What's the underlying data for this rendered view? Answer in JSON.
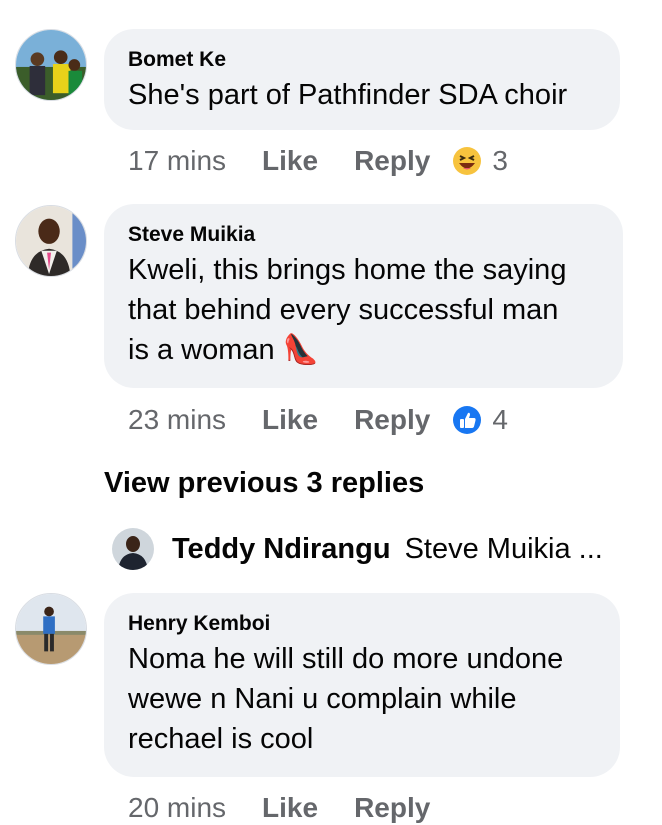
{
  "comments": [
    {
      "author": "Bomet Ke",
      "text": "She's part of Pathfinder SDA choir",
      "time": "17 mins",
      "like": "Like",
      "reply": "Reply",
      "reaction_icon": "laughing-emoji-icon",
      "reaction_count": "3"
    },
    {
      "author": "Steve Muikia",
      "text_lines": [
        "Kweli, this brings home the saying",
        "that behind every successful man",
        "is a woman 👠"
      ],
      "time": "23 mins",
      "like": "Like",
      "reply": "Reply",
      "reaction_icon": "thumbs-up-icon",
      "reaction_count": "4"
    },
    {
      "author": "Henry Kemboi",
      "text_lines": [
        "Noma he will still do more undone",
        "wewe n Nani u complain while",
        "rechael is cool"
      ],
      "time": "20 mins",
      "like": "Like",
      "reply": "Reply"
    }
  ],
  "view_previous": "View previous 3 replies",
  "reply_preview": {
    "author": "Teddy Ndirangu",
    "text": "Steve Muikia ..."
  },
  "colors": {
    "bubble": "#f0f2f5",
    "meta_text": "#65676b",
    "like_blue": "#1877f2",
    "emoji_yellow": "#f7c33e"
  }
}
